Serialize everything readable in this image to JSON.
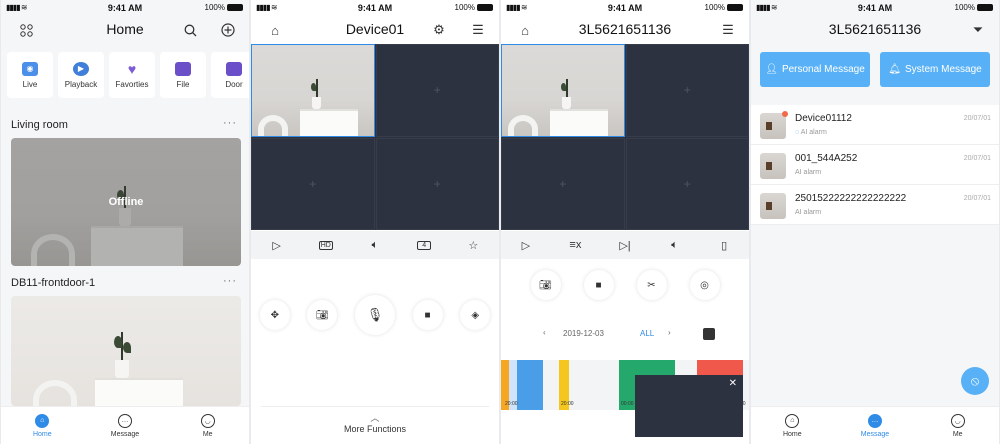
{
  "status": {
    "time": "9:41 AM",
    "battery": "100%"
  },
  "p1": {
    "title": "Home",
    "quick": [
      {
        "label": "Live",
        "color": "#4c8fe8"
      },
      {
        "label": "Playback",
        "color": "#3f7fd9"
      },
      {
        "label": "Favorties",
        "color": "#7b5cd6"
      },
      {
        "label": "File",
        "color": "#6a4fc8"
      },
      {
        "label": "Door",
        "color": "#6a4fc8"
      }
    ],
    "section1": "Living room",
    "offline": "Offline",
    "section2": "DB11-frontdoor-1",
    "more": "···",
    "tabs": [
      "Home",
      "Message",
      "Me"
    ]
  },
  "p2": {
    "title": "Device01",
    "hd": "HD",
    "split": "4",
    "more_functions": "More Functions"
  },
  "p3": {
    "title": "3L5621651136",
    "date": "2019-12-03",
    "all": "ALL",
    "time_labels": [
      "20:00",
      "20:00",
      "00:00",
      "02:00"
    ],
    "segments": [
      {
        "color": "#f5a623"
      },
      {
        "color": "#6fb3f2"
      },
      {
        "color": "#4a9ee8"
      },
      {
        "color": "#f5c61d"
      },
      {
        "color": "#e7e7e9"
      },
      {
        "color": "#25a86b"
      },
      {
        "color": "#f0584b"
      }
    ]
  },
  "p4": {
    "title": "3L5621651136",
    "personal": "Personal Message",
    "system": "System Message",
    "messages": [
      {
        "name": "Device01112",
        "sub": "AI alarm",
        "date": "20/07/01"
      },
      {
        "name": "001_544A252",
        "sub": "AI alarm",
        "date": "20/07/01"
      },
      {
        "name": "25015222222222222222",
        "sub": "AI alarm",
        "date": "20/07/01"
      }
    ],
    "tabs": [
      "Home",
      "Message",
      "Me"
    ]
  },
  "colors": {
    "accent": "#2f8be6",
    "grid_bg": "#2c3240",
    "button_blue": "#58b1f7"
  }
}
